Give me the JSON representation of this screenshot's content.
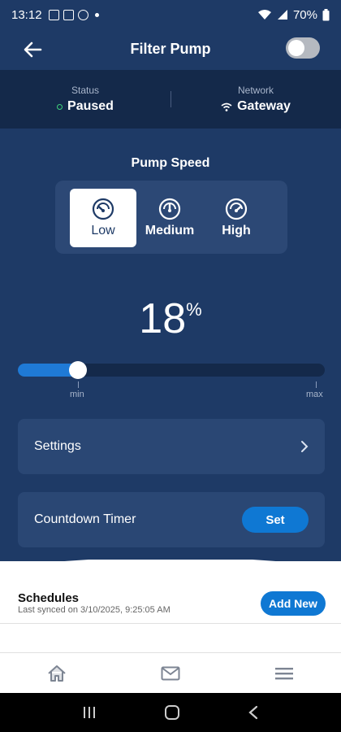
{
  "statusbar": {
    "time": "13:12",
    "battery": "70%"
  },
  "header": {
    "title": "Filter Pump",
    "toggle_on": false
  },
  "status_strip": {
    "status_label": "Status",
    "status_value": "Paused",
    "network_label": "Network",
    "network_value": "Gateway"
  },
  "pump": {
    "label": "Pump Speed",
    "options": [
      "Low",
      "Medium",
      "High"
    ],
    "selected": "Low",
    "percent": "18",
    "percent_unit": "%",
    "level": 0.18,
    "min_label": "min",
    "max_label": "max"
  },
  "settings": {
    "label": "Settings"
  },
  "timer": {
    "label": "Countdown Timer",
    "button": "Set"
  },
  "schedules": {
    "title": "Schedules",
    "synced": "Last synced on 3/10/2025, 9:25:05 AM",
    "add_button": "Add New"
  },
  "colors": {
    "accent": "#0f78d3",
    "bg": "#1e3a66",
    "strip": "#14294a",
    "status_ok": "#3fd37b"
  }
}
